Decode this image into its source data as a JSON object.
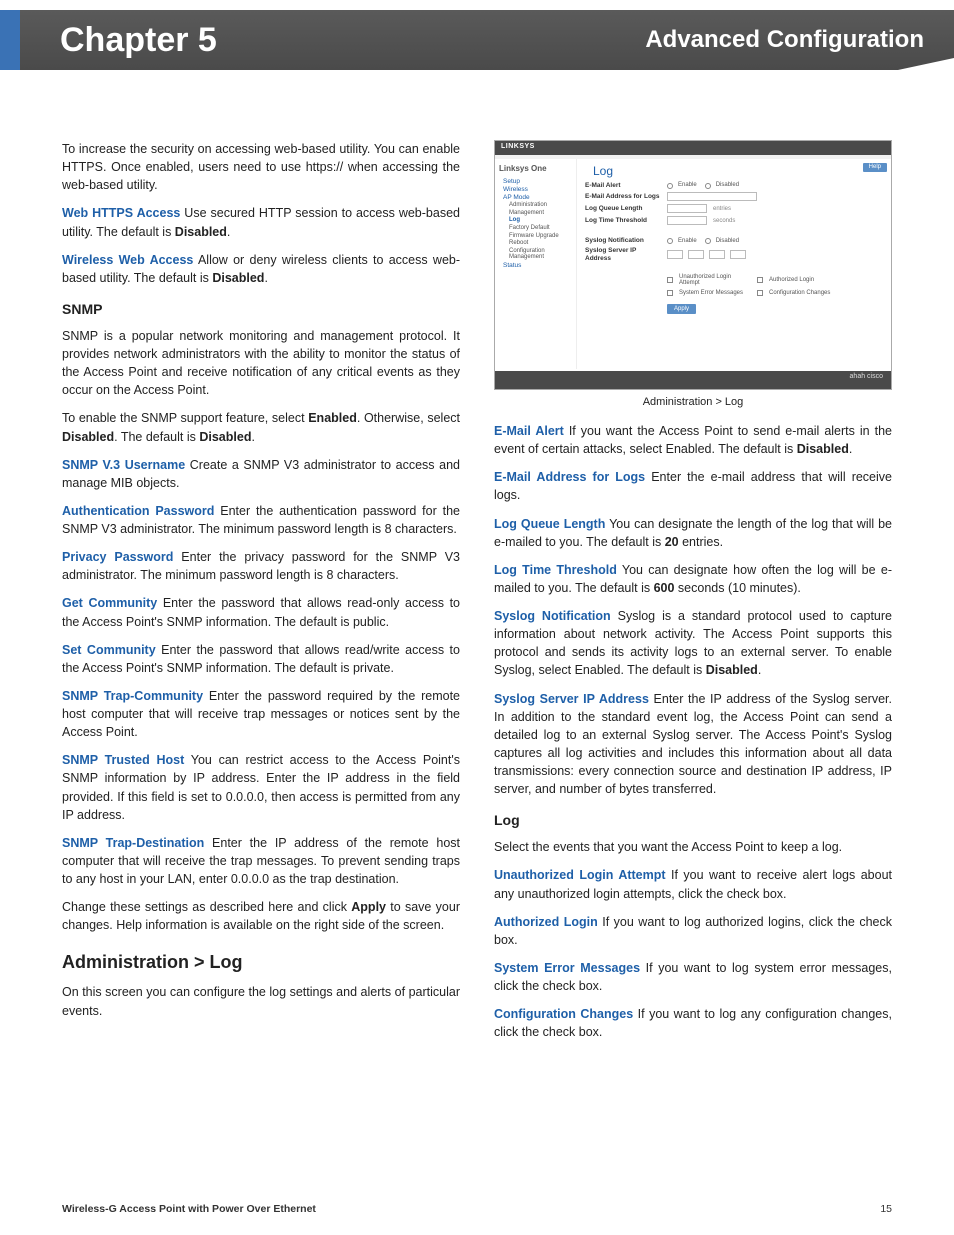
{
  "header": {
    "chapter": "Chapter 5",
    "section": "Advanced Configuration"
  },
  "col1": {
    "intro": "To increase the security on accessing web-based utility. You can enable HTTPS. Once enabled, users need to use https:// when accessing the web-based utility.",
    "p1": {
      "term": "Web HTTPS Access",
      "body": "  Use secured HTTP session to access web-based utility. The default is ",
      "bold": "Disabled",
      "tail": "."
    },
    "p2": {
      "term": "Wireless Web Access",
      "body": "  Allow or deny wireless clients to access web-based utility. The default is ",
      "bold": "Disabled",
      "tail": "."
    },
    "snmp_h": "SNMP",
    "s1": "SNMP is a popular network monitoring and management protocol. It provides network administrators with the ability to monitor the status of the Access Point and receive notification of any critical events as they occur on the Access Point.",
    "s2a": "To enable the SNMP support feature, select ",
    "s2b": "Enabled",
    "s2c": ". Otherwise, select ",
    "s2d": "Disabled",
    "s2e": ". The default is ",
    "s2f": "Disabled",
    "s2g": ".",
    "s3": {
      "term": "SNMP V.3 Username",
      "body": "  Create a SNMP V3 administrator to access and manage MIB objects."
    },
    "s4": {
      "term": "Authentication Password",
      "body": " Enter the authentication password for the SNMP V3 administrator. The minimum password length is 8 characters."
    },
    "s5": {
      "term": "Privacy Password",
      "body": "  Enter the privacy password for the SNMP V3 administrator. The minimum password length is 8 characters."
    },
    "s6": {
      "term": "Get Community",
      "body": "  Enter the password that allows read-only access to the Access Point's SNMP information. The default is public."
    },
    "s7": {
      "term": "Set Community",
      "body": "  Enter the password that allows read/write access to the Access Point's SNMP information. The default is private."
    },
    "s8": {
      "term": "SNMP Trap-Community",
      "body": "  Enter the password required by the remote host computer that will receive trap messages or notices sent by the Access Point."
    },
    "s9": {
      "term": "SNMP Trusted Host",
      "body": "  You can restrict access to the Access Point's SNMP information by IP address. Enter the IP address in the field provided. If this field is set to 0.0.0.0, then access is permitted from any IP address."
    },
    "s10": {
      "term": "SNMP Trap-Destination",
      "body": "  Enter the IP address of the remote host computer that will receive the trap messages. To prevent sending traps to any host in your LAN, enter 0.0.0.0 as the trap destination."
    },
    "s11a": "Change these settings as described here and click ",
    "s11b": "Apply",
    "s11c": " to save your changes. Help information is available on the right side of the screen.",
    "log_h": "Administration > Log",
    "log_intro": "On this screen you can configure the log settings and alerts of particular events."
  },
  "router": {
    "brand": "LINKSYS",
    "crumb": "Linksys One",
    "title": "Log",
    "help": "Help",
    "nav": {
      "setup": "Setup",
      "wireless": "Wireless",
      "apmode": "AP Mode",
      "admin": "Administration",
      "mgmt": "Management",
      "log": "Log",
      "factory": "Factory Default",
      "fw": "Firmware Upgrade",
      "reboot": "Reboot",
      "cfg": "Configuration Management",
      "status": "Status"
    },
    "labels": {
      "email": "E-Mail Alert",
      "emailaddr": "E-Mail Address for Logs",
      "queue": "Log Queue Length",
      "time": "Log Time Threshold",
      "syslog": "Syslog Notification",
      "syslogip": "Syslog Server IP Address"
    },
    "enable": "Enable",
    "disable": "Disabled",
    "entries": "entries",
    "seconds": "seconds",
    "checks": {
      "c1": "Unauthorized Login Attempt",
      "c2": "Authorized Login",
      "c3": "System Error Messages",
      "c4": "Configuration Changes"
    },
    "apply": "Apply",
    "foot": "ahah\ncisco"
  },
  "figcap": "Administration > Log",
  "col2": {
    "p1": {
      "term": "E-Mail Alert",
      "body": "  If you want the Access Point to send e-mail alerts in the event of certain attacks, select Enabled. The default is ",
      "bold": "Disabled",
      "tail": "."
    },
    "p2": {
      "term": "E-Mail Address for Logs",
      "body": "  Enter the e-mail address that will receive logs."
    },
    "p3": {
      "term": "Log Queue Length",
      "body": "  You can designate the length of the log that will be e-mailed to you. The default is ",
      "bold": "20",
      "tail": " entries."
    },
    "p4": {
      "term": "Log Time Threshold",
      "body": "  You can designate how often the log will be e-mailed to you. The default is ",
      "bold": "600",
      "tail": " seconds (10 minutes)."
    },
    "p5": {
      "term": "Syslog Notification",
      "body": "  Syslog is a standard protocol used to capture information about network activity. The Access Point supports this protocol and sends its activity logs to an external server. To enable Syslog, select Enabled. The default is ",
      "bold": "Disabled",
      "tail": "."
    },
    "p6": {
      "term": "Syslog Server IP Address",
      "body": "  Enter the IP address of the Syslog server. In addition to the standard event log, the Access Point can send a detailed log to an external Syslog server. The Access Point's Syslog captures all log activities and includes this information about all data transmissions: every connection source and destination IP address, IP server, and number of bytes transferred."
    },
    "log_h": "Log",
    "log_intro": "Select the events that you want the Access Point to keep a log.",
    "l1": {
      "term": "Unauthorized Login Attempt",
      "body": "  If you want to receive alert logs about any unauthorized login attempts, click the check box."
    },
    "l2": {
      "term": "Authorized Login",
      "body": "  If you want to log authorized logins, click the check box."
    },
    "l3": {
      "term": "System Error Messages",
      "body": "  If you want to log system error messages, click the check box."
    },
    "l4": {
      "term": "Configuration Changes",
      "body": "  If you want to log any configuration changes, click the check box."
    }
  },
  "footer": {
    "left": "Wireless-G Access Point with  Power Over Ethernet",
    "right": "15"
  }
}
